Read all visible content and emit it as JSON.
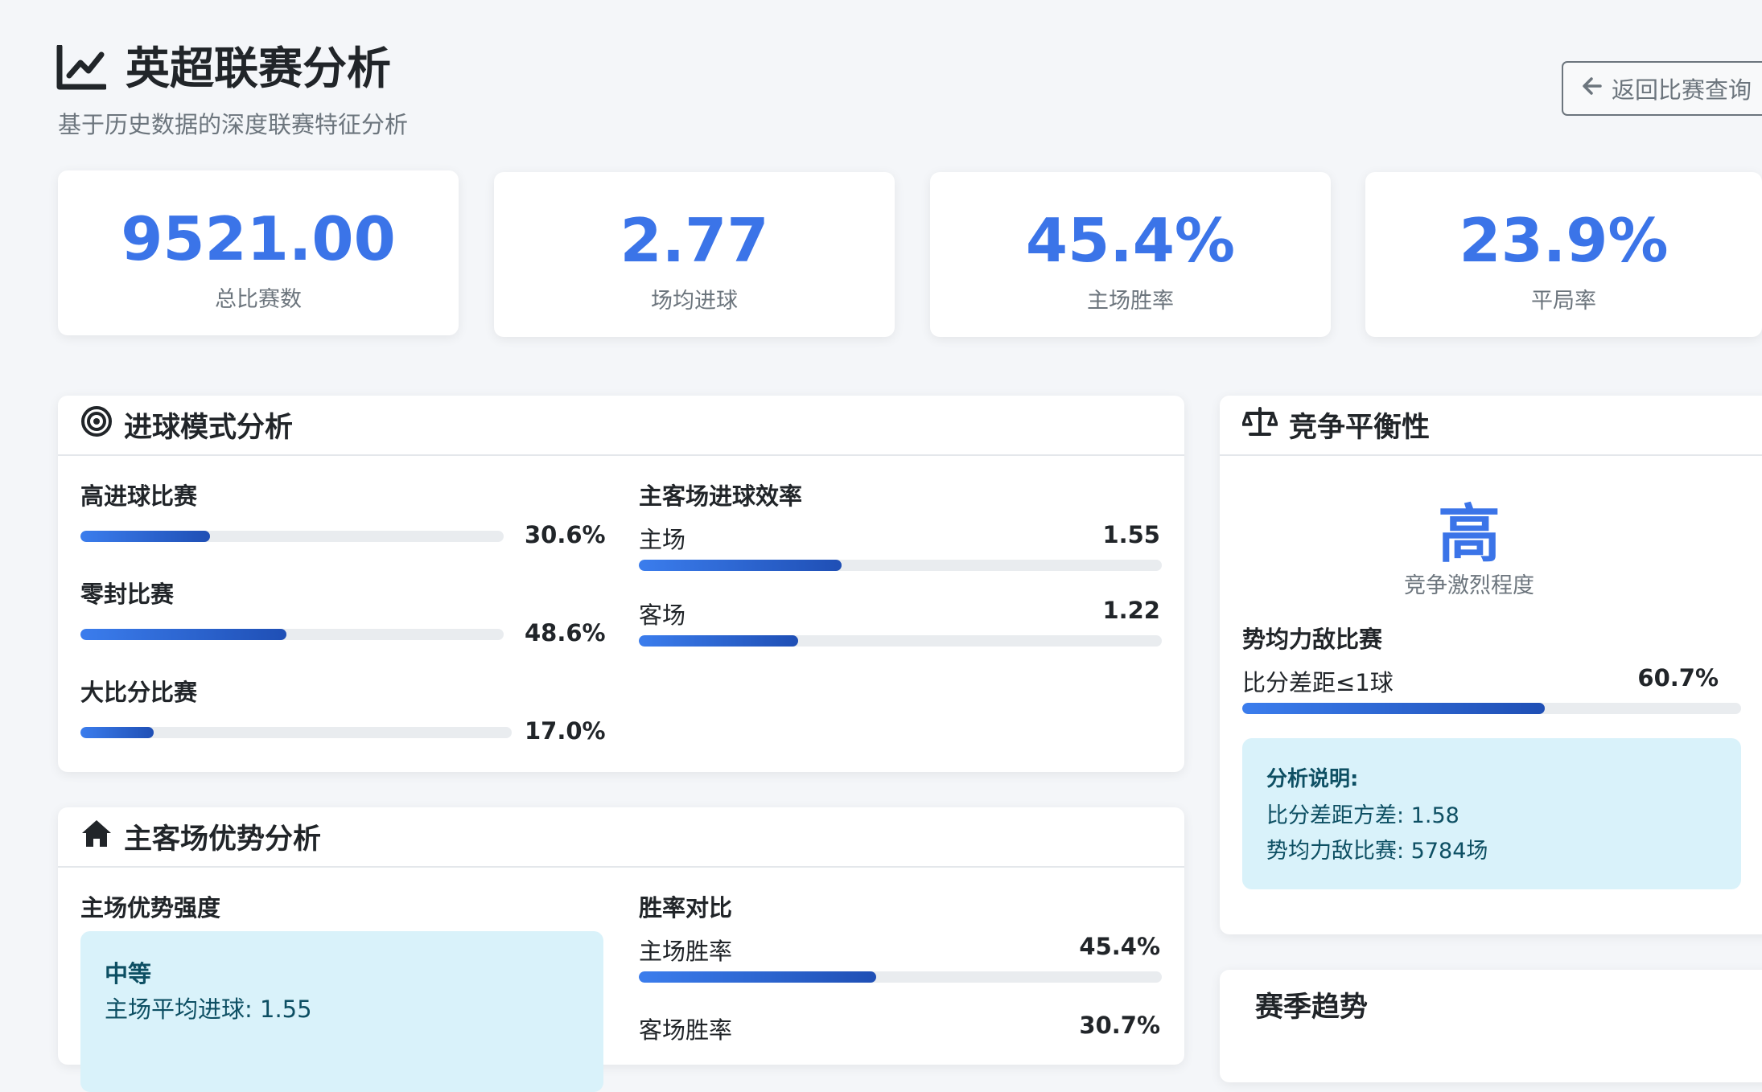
{
  "header": {
    "title": "英超联赛分析",
    "subtitle": "基于历史数据的深度联赛特征分析",
    "back_label": "返回比赛查询"
  },
  "stats": [
    {
      "value": "9521.00",
      "label": "总比赛数"
    },
    {
      "value": "2.77",
      "label": "场均进球"
    },
    {
      "value": "45.4%",
      "label": "主场胜率"
    },
    {
      "value": "23.9%",
      "label": "平局率"
    }
  ],
  "scoring": {
    "title": "进球模式分析",
    "bars": [
      {
        "label": "高进球比赛",
        "value": "30.6%",
        "percent": 30.6
      },
      {
        "label": "零封比赛",
        "value": "48.6%",
        "percent": 48.6
      },
      {
        "label": "大比分比赛",
        "value": "17.0%",
        "percent": 17.0
      }
    ],
    "efficiency": {
      "title": "主客场进球效率",
      "rows": [
        {
          "label": "主场",
          "value": "1.55",
          "percent": 38.75
        },
        {
          "label": "客场",
          "value": "1.22",
          "percent": 30.5
        }
      ]
    }
  },
  "balance": {
    "title": "竞争平衡性",
    "level": "高",
    "level_label": "竞争激烈程度",
    "even_title": "势均力敌比赛",
    "even_label": "比分差距≤1球",
    "even_value": "60.7%",
    "even_percent": 60.7,
    "note_title": "分析说明:",
    "note_lines": [
      "比分差距方差: 1.58",
      "势均力敌比赛: 5784场"
    ]
  },
  "home": {
    "title": "主客场优势分析",
    "strength_title": "主场优势强度",
    "strength_level": "中等",
    "strength_line": "主场平均进球: 1.55",
    "winrate_title": "胜率对比",
    "rows": [
      {
        "label": "主场胜率",
        "value": "45.4%",
        "percent": 45.4
      },
      {
        "label": "客场胜率",
        "value": "30.7%",
        "percent": 30.7
      }
    ]
  },
  "season": {
    "title": "赛季趋势"
  },
  "colors": {
    "accent": "#3b74e8",
    "bar_start": "#3b7ded",
    "bar_end": "#1f4fb5",
    "info_bg": "#d9f2fa",
    "info_text": "#0d4f63"
  }
}
